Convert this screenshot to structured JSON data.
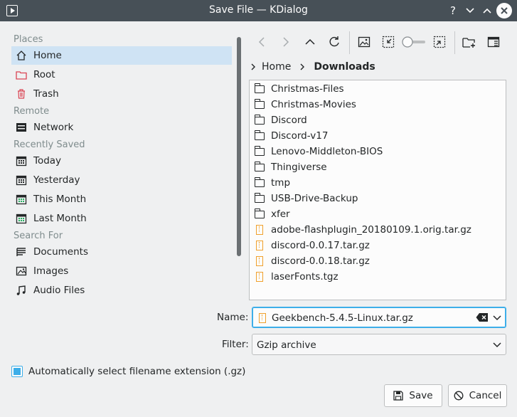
{
  "window": {
    "title": "Save File — KDialog",
    "help_glyph": "?",
    "minimize_glyph": "⌄",
    "maximize_glyph": "⌃",
    "close_glyph": "✕"
  },
  "sidebar": {
    "sections": [
      {
        "label": "Places",
        "items": [
          {
            "label": "Home",
            "icon": "home-icon",
            "selected": true
          },
          {
            "label": "Root",
            "icon": "folder-red-icon"
          },
          {
            "label": "Trash",
            "icon": "trash-icon"
          }
        ]
      },
      {
        "label": "Remote",
        "items": [
          {
            "label": "Network",
            "icon": "network-icon"
          }
        ]
      },
      {
        "label": "Recently Saved",
        "items": [
          {
            "label": "Today",
            "icon": "calendar-icon"
          },
          {
            "label": "Yesterday",
            "icon": "calendar-icon"
          },
          {
            "label": "This Month",
            "icon": "calendar-icon"
          },
          {
            "label": "Last Month",
            "icon": "calendar-icon"
          }
        ]
      },
      {
        "label": "Search For",
        "items": [
          {
            "label": "Documents",
            "icon": "documents-icon"
          },
          {
            "label": "Images",
            "icon": "images-icon"
          },
          {
            "label": "Audio Files",
            "icon": "audio-icon"
          }
        ]
      }
    ]
  },
  "toolbar": {
    "icons": [
      "back-icon",
      "forward-icon",
      "up-icon",
      "reload-icon",
      "preview-icon",
      "zoom-icon",
      "zoom-slider",
      "select-icon",
      "new-folder-icon",
      "details-view-icon"
    ]
  },
  "breadcrumb": {
    "items": [
      "Home",
      "Downloads"
    ]
  },
  "files": [
    {
      "name": "Christmas-Files",
      "type": "folder"
    },
    {
      "name": "Christmas-Movies",
      "type": "folder"
    },
    {
      "name": "Discord",
      "type": "folder"
    },
    {
      "name": "Discord-v17",
      "type": "folder"
    },
    {
      "name": "Lenovo-Middleton-BIOS",
      "type": "folder"
    },
    {
      "name": "Thingiverse",
      "type": "folder"
    },
    {
      "name": "tmp",
      "type": "folder"
    },
    {
      "name": "USB-Drive-Backup",
      "type": "folder"
    },
    {
      "name": "xfer",
      "type": "folder"
    },
    {
      "name": "adobe-flashplugin_20180109.1.orig.tar.gz",
      "type": "archive"
    },
    {
      "name": "discord-0.0.17.tar.gz",
      "type": "archive"
    },
    {
      "name": "discord-0.0.18.tar.gz",
      "type": "archive"
    },
    {
      "name": "laserFonts.tgz",
      "type": "archive"
    }
  ],
  "form": {
    "name_label": "Name:",
    "name_value": "Geekbench-5.4.5-Linux.tar.gz",
    "filter_label": "Filter:",
    "filter_value": "Gzip archive",
    "auto_ext_label": "Automatically select filename extension (.gz)",
    "auto_ext_checked": true
  },
  "buttons": {
    "save": "Save",
    "cancel": "Cancel"
  },
  "colors": {
    "titlebar": "#475057",
    "accent": "#3daee9",
    "selection": "#cfe3f4",
    "archive": "#f0a02b",
    "root_folder": "#da4453"
  }
}
